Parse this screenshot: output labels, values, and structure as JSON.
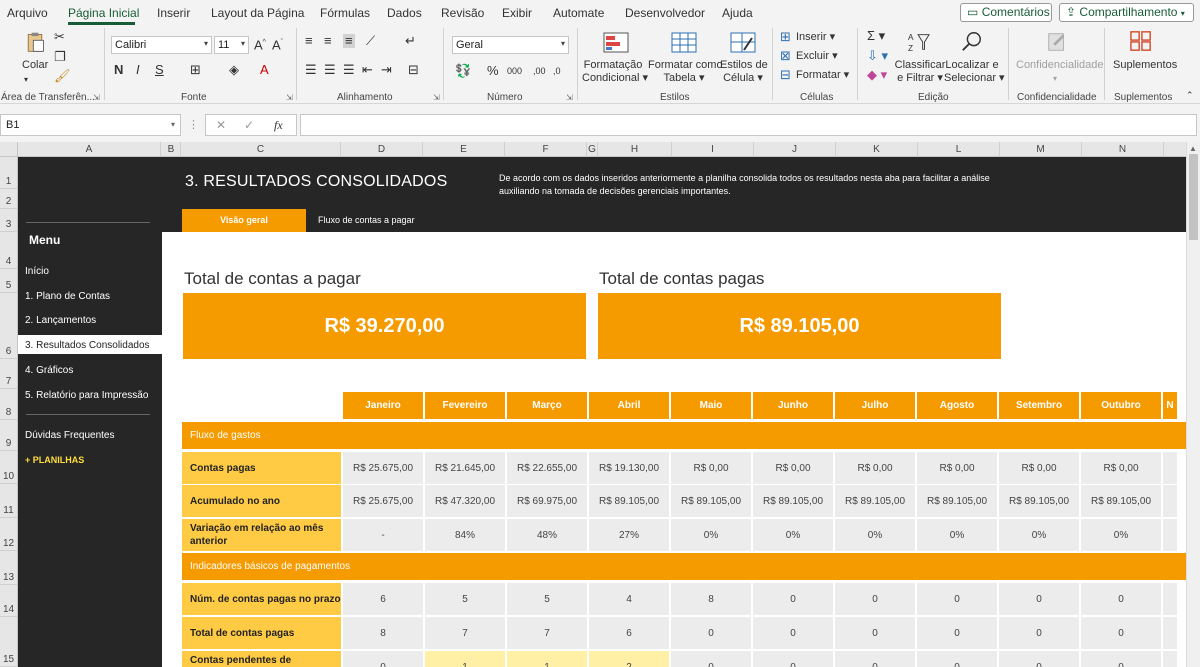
{
  "menu": {
    "tabs": [
      "Arquivo",
      "Página Inicial",
      "Inserir",
      "Layout da Página",
      "Fórmulas",
      "Dados",
      "Revisão",
      "Exibir",
      "Automate",
      "Desenvolvedor",
      "Ajuda"
    ],
    "comments": "Comentários",
    "share": "Compartilhamento"
  },
  "ribbon": {
    "paste": "Colar",
    "font_name": "Calibri",
    "font_size": "11",
    "number_format": "Geral",
    "cond_format": [
      "Formatação",
      "Condicional"
    ],
    "format_table": [
      "Formatar como",
      "Tabela"
    ],
    "cell_styles": [
      "Estilos de",
      "Célula"
    ],
    "insert": "Inserir",
    "delete": "Excluir",
    "format": "Formatar",
    "sort": [
      "Classificar",
      "e Filtrar"
    ],
    "find": [
      "Localizar e",
      "Selecionar"
    ],
    "confidentiality": "Confidencialidade",
    "addins": "Suplementos",
    "groups": {
      "clipboard": "Área de Transferên...",
      "font": "Fonte",
      "alignment": "Alinhamento",
      "number": "Número",
      "styles": "Estilos",
      "cells": "Células",
      "editing": "Edição",
      "confidentiality": "Confidencialidade",
      "addins": "Suplementos"
    }
  },
  "formula_bar": {
    "name_box": "B1",
    "fx": "fx",
    "content": ""
  },
  "grid": {
    "columns": [
      "A",
      "B",
      "C",
      "D",
      "E",
      "F",
      "G",
      "H",
      "I",
      "J",
      "K",
      "L",
      "M",
      "N"
    ],
    "rows": [
      "1",
      "2",
      "3",
      "4",
      "5",
      "6",
      "7",
      "8",
      "9",
      "10",
      "11",
      "12",
      "13",
      "14",
      "15"
    ]
  },
  "sidebar": {
    "title": "Menu",
    "items": [
      "Início",
      "1. Plano de Contas",
      "2. Lançamentos",
      "3. Resultados Consolidados",
      "4. Gráficos",
      "5. Relatório para Impressão"
    ],
    "faq": "Dúvidas Frequentes",
    "more": "+ PLANILHAS"
  },
  "header": {
    "title": "3. RESULTADOS CONSOLIDADOS",
    "description": "De acordo com os dados inseridos anteriormente a planilha consolida todos os resultados nesta aba para facilitar a análise auxiliando na tomada de decisões gerenciais importantes.",
    "tab_overview": "Visão geral",
    "tab_flow": "Fluxo de contas a pagar"
  },
  "kpis": {
    "to_pay_label": "Total de contas a pagar",
    "to_pay_value": "R$ 39.270,00",
    "paid_label": "Total de contas pagas",
    "paid_value": "R$ 89.105,00"
  },
  "table": {
    "months": [
      "Janeiro",
      "Fevereiro",
      "Março",
      "Abril",
      "Maio",
      "Junho",
      "Julho",
      "Agosto",
      "Setembro",
      "Outubro",
      "N"
    ],
    "section1": "Fluxo de gastos",
    "section2": "Indicadores básicos de pagamentos",
    "rows": [
      {
        "label": "Contas pagas",
        "values": [
          "R$ 25.675,00",
          "R$ 21.645,00",
          "R$ 22.655,00",
          "R$ 19.130,00",
          "R$ 0,00",
          "R$ 0,00",
          "R$ 0,00",
          "R$ 0,00",
          "R$ 0,00",
          "R$ 0,00"
        ]
      },
      {
        "label": "Acumulado no ano",
        "values": [
          "R$ 25.675,00",
          "R$ 47.320,00",
          "R$ 69.975,00",
          "R$ 89.105,00",
          "R$ 89.105,00",
          "R$ 89.105,00",
          "R$ 89.105,00",
          "R$ 89.105,00",
          "R$ 89.105,00",
          "R$ 89.105,00"
        ]
      },
      {
        "label": "Variação em relação ao mês anterior",
        "values": [
          "-",
          "84%",
          "48%",
          "27%",
          "0%",
          "0%",
          "0%",
          "0%",
          "0%",
          "0%"
        ]
      },
      {
        "label": "Núm. de contas pagas no prazo",
        "values": [
          "6",
          "5",
          "5",
          "4",
          "8",
          "0",
          "0",
          "0",
          "0",
          "0"
        ]
      },
      {
        "label": "Total de contas pagas",
        "values": [
          "8",
          "7",
          "7",
          "6",
          "0",
          "0",
          "0",
          "0",
          "0",
          "0"
        ]
      },
      {
        "label": "Contas pendentes de pagamento",
        "values": [
          "0",
          "1",
          "1",
          "2",
          "0",
          "0",
          "0",
          "0",
          "0",
          "0"
        ]
      }
    ]
  },
  "colors": {
    "accent": "#f59b00",
    "label_fill": "#ffcb45",
    "dark": "#262626",
    "excel_green": "#185c37"
  }
}
